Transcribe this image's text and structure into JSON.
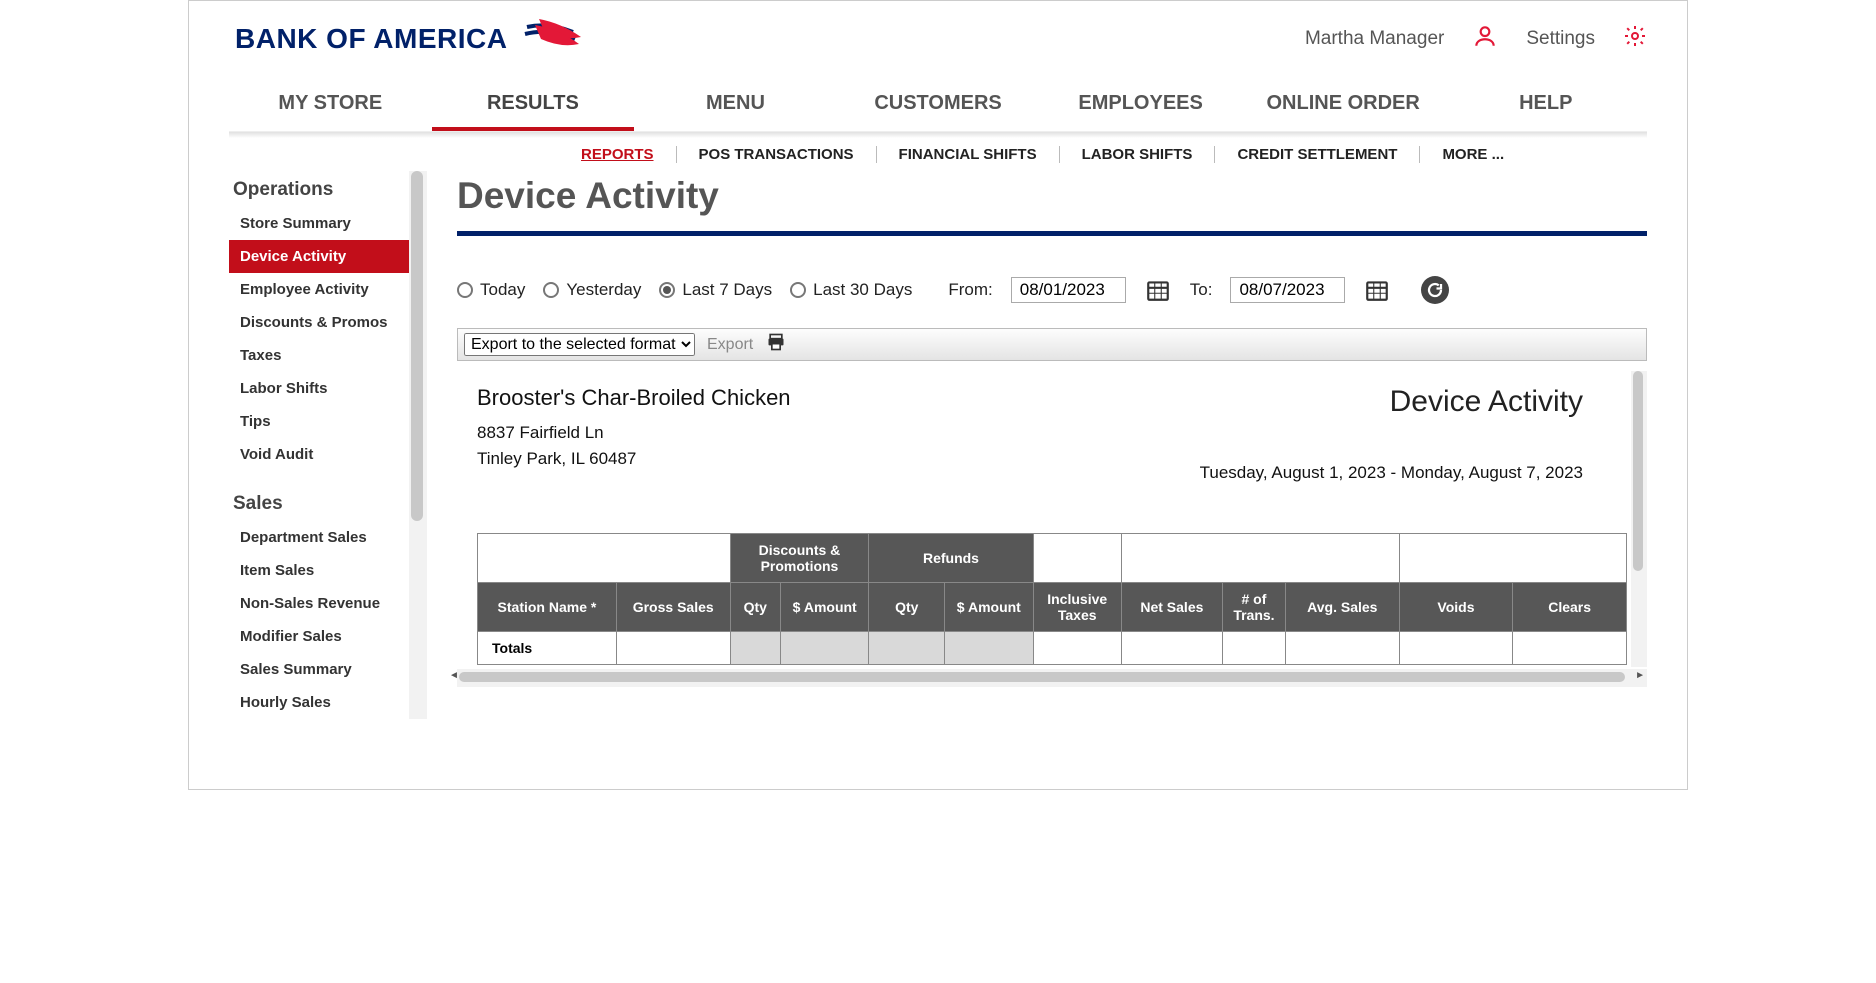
{
  "header": {
    "brand": "BANK OF AMERICA",
    "user": "Martha Manager",
    "settings": "Settings"
  },
  "nav1": {
    "items": [
      "MY STORE",
      "RESULTS",
      "MENU",
      "CUSTOMERS",
      "EMPLOYEES",
      "ONLINE ORDER",
      "HELP"
    ],
    "activeIndex": 1
  },
  "nav2": {
    "items": [
      "REPORTS",
      "POS TRANSACTIONS",
      "FINANCIAL SHIFTS",
      "LABOR SHIFTS",
      "CREDIT SETTLEMENT",
      "MORE ..."
    ],
    "activeIndex": 0
  },
  "sidebar": {
    "groups": [
      {
        "title": "Operations",
        "items": [
          "Store Summary",
          "Device Activity",
          "Employee Activity",
          "Discounts & Promos",
          "Taxes",
          "Labor Shifts",
          "Tips",
          "Void Audit"
        ],
        "activeIndex": 1
      },
      {
        "title": "Sales",
        "items": [
          "Department Sales",
          "Item Sales",
          "Non-Sales Revenue",
          "Modifier Sales",
          "Sales Summary",
          "Hourly Sales"
        ],
        "activeIndex": -1
      }
    ]
  },
  "page": {
    "title": "Device Activity"
  },
  "dateFilter": {
    "options": [
      "Today",
      "Yesterday",
      "Last 7 Days",
      "Last 30 Days"
    ],
    "selectedIndex": 2,
    "fromLabel": "From:",
    "fromValue": "08/01/2023",
    "toLabel": "To:",
    "toValue": "08/07/2023"
  },
  "exportBar": {
    "selectLabel": "Export to the selected format",
    "exportLink": "Export"
  },
  "report": {
    "storeName": "Brooster's Char-Broiled Chicken",
    "address1": "8837 Fairfield Ln",
    "address2": "Tinley Park, IL 60487",
    "title": "Device Activity",
    "dateRange": "Tuesday, August 1, 2023 - Monday, August 7, 2023",
    "groupHeaders": {
      "discounts": "Discounts & Promotions",
      "refunds": "Refunds"
    },
    "columns": [
      "Station Name *",
      "Gross Sales",
      "Qty",
      "$ Amount",
      "Qty",
      "$ Amount",
      "Inclusive Taxes",
      "Net Sales",
      "# of Trans.",
      "Avg. Sales",
      "Voids",
      "Clears"
    ],
    "totalsLabel": "Totals"
  }
}
